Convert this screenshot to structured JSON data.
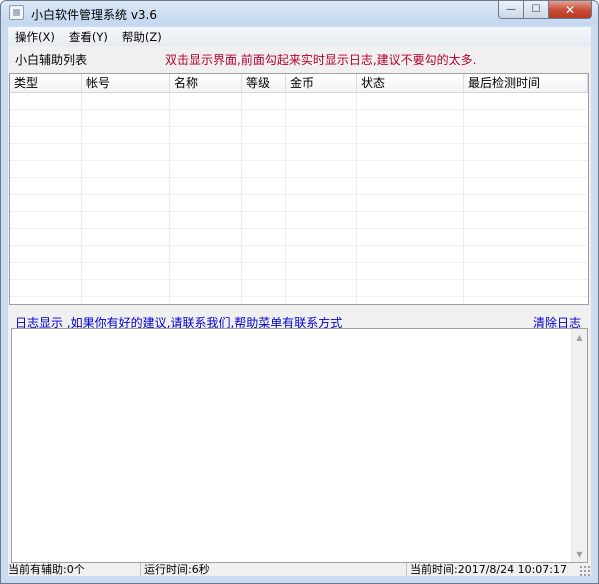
{
  "window": {
    "title": "小白软件管理系统  v3.6",
    "minimize_glyph": "—",
    "maximize_glyph": "☐",
    "close_glyph": "✕"
  },
  "menu": {
    "items": [
      "操作(X)",
      "查看(Y)",
      "帮助(Z)"
    ]
  },
  "list_section": {
    "label": "小白辅助列表",
    "hint": "双击显示界面,前面勾起来实时显示日志,建议不要勾的太多."
  },
  "table": {
    "columns": [
      "类型",
      "帐号",
      "名称",
      "等级",
      "金币",
      "状态",
      "最后检测时间"
    ],
    "rows": []
  },
  "log_section": {
    "label": "日志显示  ,如果你有好的建议,请联系我们,帮助菜单有联系方式",
    "clear_label": "清除日志",
    "content": ""
  },
  "statusbar": {
    "assist_count": "当前有辅助:0个",
    "run_time": "运行时间:6秒",
    "current_time": "当前时间:2017/8/24 10:07:17"
  },
  "icons": {
    "app": "app-window-icon",
    "scroll_up": "scroll-up-arrow-icon",
    "scroll_down": "scroll-down-arrow-icon",
    "size_grip": "size-grip-icon"
  }
}
